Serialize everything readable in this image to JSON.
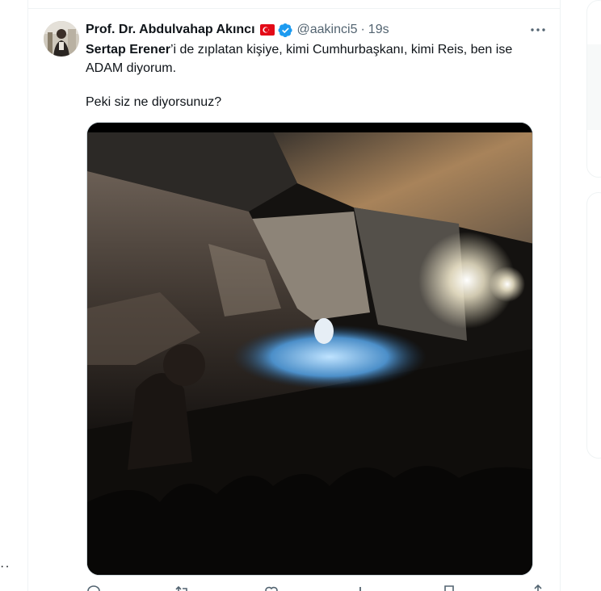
{
  "tweet": {
    "author_name": "Prof. Dr. Abdulvahap Akıncı",
    "handle": "@aakinci5",
    "separator": "·",
    "time": "19s",
    "mention": "Sertap Erener",
    "text_line1_rest": "’i de zıplatan kişiye, kimi Cumhurbaşkanı, kimi Reis, ben ise ADAM diyorum.",
    "text_line2": "Peki siz ne diyorsunuz?"
  },
  "left_edge": {
    "ellipsis": "··"
  },
  "colors": {
    "text_primary": "#0f1419",
    "text_secondary": "#536471",
    "verified_blue": "#1d9bf0",
    "flag_red": "#e30a17",
    "border": "#eff3f4"
  },
  "icons": {
    "more": "more-horizontal-icon",
    "verified": "verified-badge-icon",
    "flag": "turkey-flag-icon",
    "actions": [
      "reply-icon",
      "repost-icon",
      "like-icon",
      "views-icon",
      "bookmark-icon",
      "share-icon"
    ]
  }
}
